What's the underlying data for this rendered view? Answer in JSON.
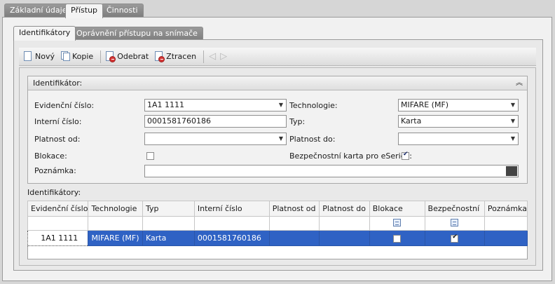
{
  "top_tabs": [
    {
      "label": "Základní údaje",
      "active": false
    },
    {
      "label": "Přístup",
      "active": true
    },
    {
      "label": "Činnosti",
      "active": false
    }
  ],
  "sub_tabs": [
    {
      "label": "Identifikátory",
      "active": true
    },
    {
      "label": "Oprávnění přístupu na snímače",
      "active": false
    }
  ],
  "toolbar": {
    "new_label": "Nový",
    "copy_label": "Kopie",
    "remove_label": "Odebrat",
    "lost_label": "Ztracen"
  },
  "group": {
    "title": "Identifikátor:",
    "evidencni_label": "Evidenční číslo:",
    "evidencni_value": "1A1 1111",
    "technologie_label": "Technologie:",
    "technologie_value": "MIFARE (MF)",
    "interni_label": "Interní číslo:",
    "interni_value": "0001581760186",
    "typ_label": "Typ:",
    "typ_value": "Karta",
    "platnost_od_label": "Platnost od:",
    "platnost_od_value": "",
    "platnost_do_label": "Platnost do:",
    "platnost_do_value": "",
    "blokace_label": "Blokace:",
    "blokace_checked": false,
    "bezpecnostni_label": "Bezpečnostní karta pro eSeries:",
    "bezpecnostni_checked": true,
    "poznamka_label": "Poznámka:",
    "poznamka_value": ""
  },
  "grid": {
    "title": "Identifikátory:",
    "columns": [
      "Evidenční číslo",
      "Technologie",
      "Typ",
      "Interní číslo",
      "Platnost od",
      "Platnost do",
      "Blokace",
      "Bezpečnostní",
      "Poznámka"
    ],
    "rows": [
      {
        "evidencni": "1A1 1111",
        "technologie": "MIFARE (MF)",
        "typ": "Karta",
        "interni": "0001581760186",
        "platnost_od": "",
        "platnost_do": "",
        "blokace": false,
        "bezpecnostni": true,
        "poznamka": ""
      }
    ]
  },
  "colors": {
    "selection": "#2f62c4",
    "tab_inactive": "#8a8a8a"
  }
}
